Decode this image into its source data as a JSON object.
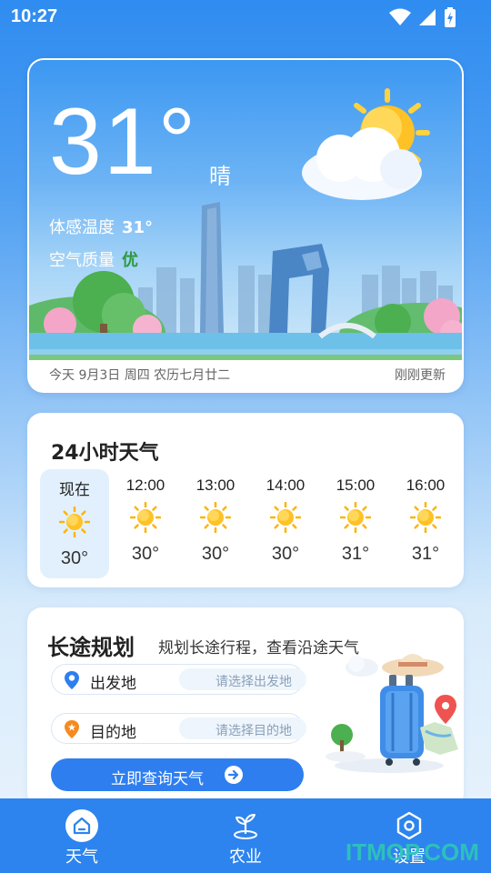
{
  "status_bar": {
    "time": "10:27"
  },
  "weather": {
    "temperature": "31°",
    "condition": "晴",
    "feels_label": "体感温度",
    "feels_value": "31°",
    "aqi_label": "空气质量",
    "aqi_value": "优",
    "date_line": "今天 9月3日 周四 农历七月廿二",
    "updated": "刚刚更新"
  },
  "hourly": {
    "title": "24小时天气",
    "items": [
      {
        "time": "现在",
        "icon": "sun-icon",
        "temp": "30°"
      },
      {
        "time": "12:00",
        "icon": "sun-icon",
        "temp": "30°"
      },
      {
        "time": "13:00",
        "icon": "sun-icon",
        "temp": "30°"
      },
      {
        "time": "14:00",
        "icon": "sun-icon",
        "temp": "30°"
      },
      {
        "time": "15:00",
        "icon": "sun-icon",
        "temp": "31°"
      },
      {
        "time": "16:00",
        "icon": "sun-icon",
        "temp": "31°"
      }
    ]
  },
  "trip": {
    "title": "长途规划",
    "subtitle": "规划长途行程，查看沿途天气",
    "origin_label": "出发地",
    "origin_placeholder": "请选择出发地",
    "dest_label": "目的地",
    "dest_placeholder": "请选择目的地",
    "button_label": "立即查询天气"
  },
  "nav": {
    "items": [
      {
        "label": "天气",
        "icon": "home-icon",
        "active": true
      },
      {
        "label": "农业",
        "icon": "sprout-icon",
        "active": false
      },
      {
        "label": "设置",
        "icon": "settings-icon",
        "active": false
      }
    ]
  },
  "watermark": "ITMOP.COM",
  "colors": {
    "accent": "#2e7ef0",
    "aqi_good": "#2f9a3f",
    "nav_bg": "#2d84ee"
  }
}
